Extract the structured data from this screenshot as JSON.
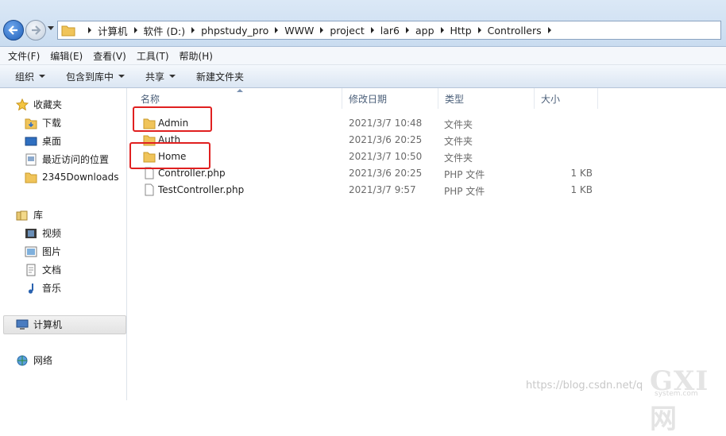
{
  "window": {
    "title": ""
  },
  "address": {
    "crumbs": [
      "计算机",
      "软件 (D:)",
      "phpstudy_pro",
      "WWW",
      "project",
      "lar6",
      "app",
      "Http",
      "Controllers"
    ]
  },
  "menu": [
    "文件(F)",
    "编辑(E)",
    "查看(V)",
    "工具(T)",
    "帮助(H)"
  ],
  "toolbar": {
    "organize": "组织",
    "include_library": "包含到库中",
    "share": "共享",
    "new_folder": "新建文件夹"
  },
  "nav": {
    "favorites": "收藏夹",
    "downloads": "下载",
    "desktop": "桌面",
    "recent": "最近访问的位置",
    "downloads2345": "2345Downloads",
    "library": "库",
    "videos": "视频",
    "pictures": "图片",
    "documents": "文档",
    "music": "音乐",
    "computer": "计算机",
    "network": "网络"
  },
  "columns": {
    "name": "名称",
    "date": "修改日期",
    "type": "类型",
    "size": "大小"
  },
  "files": [
    {
      "name": "Admin",
      "date": "2021/3/7 10:48",
      "type": "文件夹",
      "size": ""
    },
    {
      "name": "Auth",
      "date": "2021/3/6 20:25",
      "type": "文件夹",
      "size": ""
    },
    {
      "name": "Home",
      "date": "2021/3/7 10:50",
      "type": "文件夹",
      "size": ""
    },
    {
      "name": "Controller.php",
      "date": "2021/3/6 20:25",
      "type": "PHP 文件",
      "size": "1 KB"
    },
    {
      "name": "TestController.php",
      "date": "2021/3/7 9:57",
      "type": "PHP 文件",
      "size": "1 KB"
    }
  ],
  "watermark": "https://blog.csdn.net/q",
  "logo": {
    "main": "GXI网",
    "sub": "system.com"
  },
  "colors": {
    "highlight_box": "#e02020",
    "folder": "#e8b64a"
  }
}
